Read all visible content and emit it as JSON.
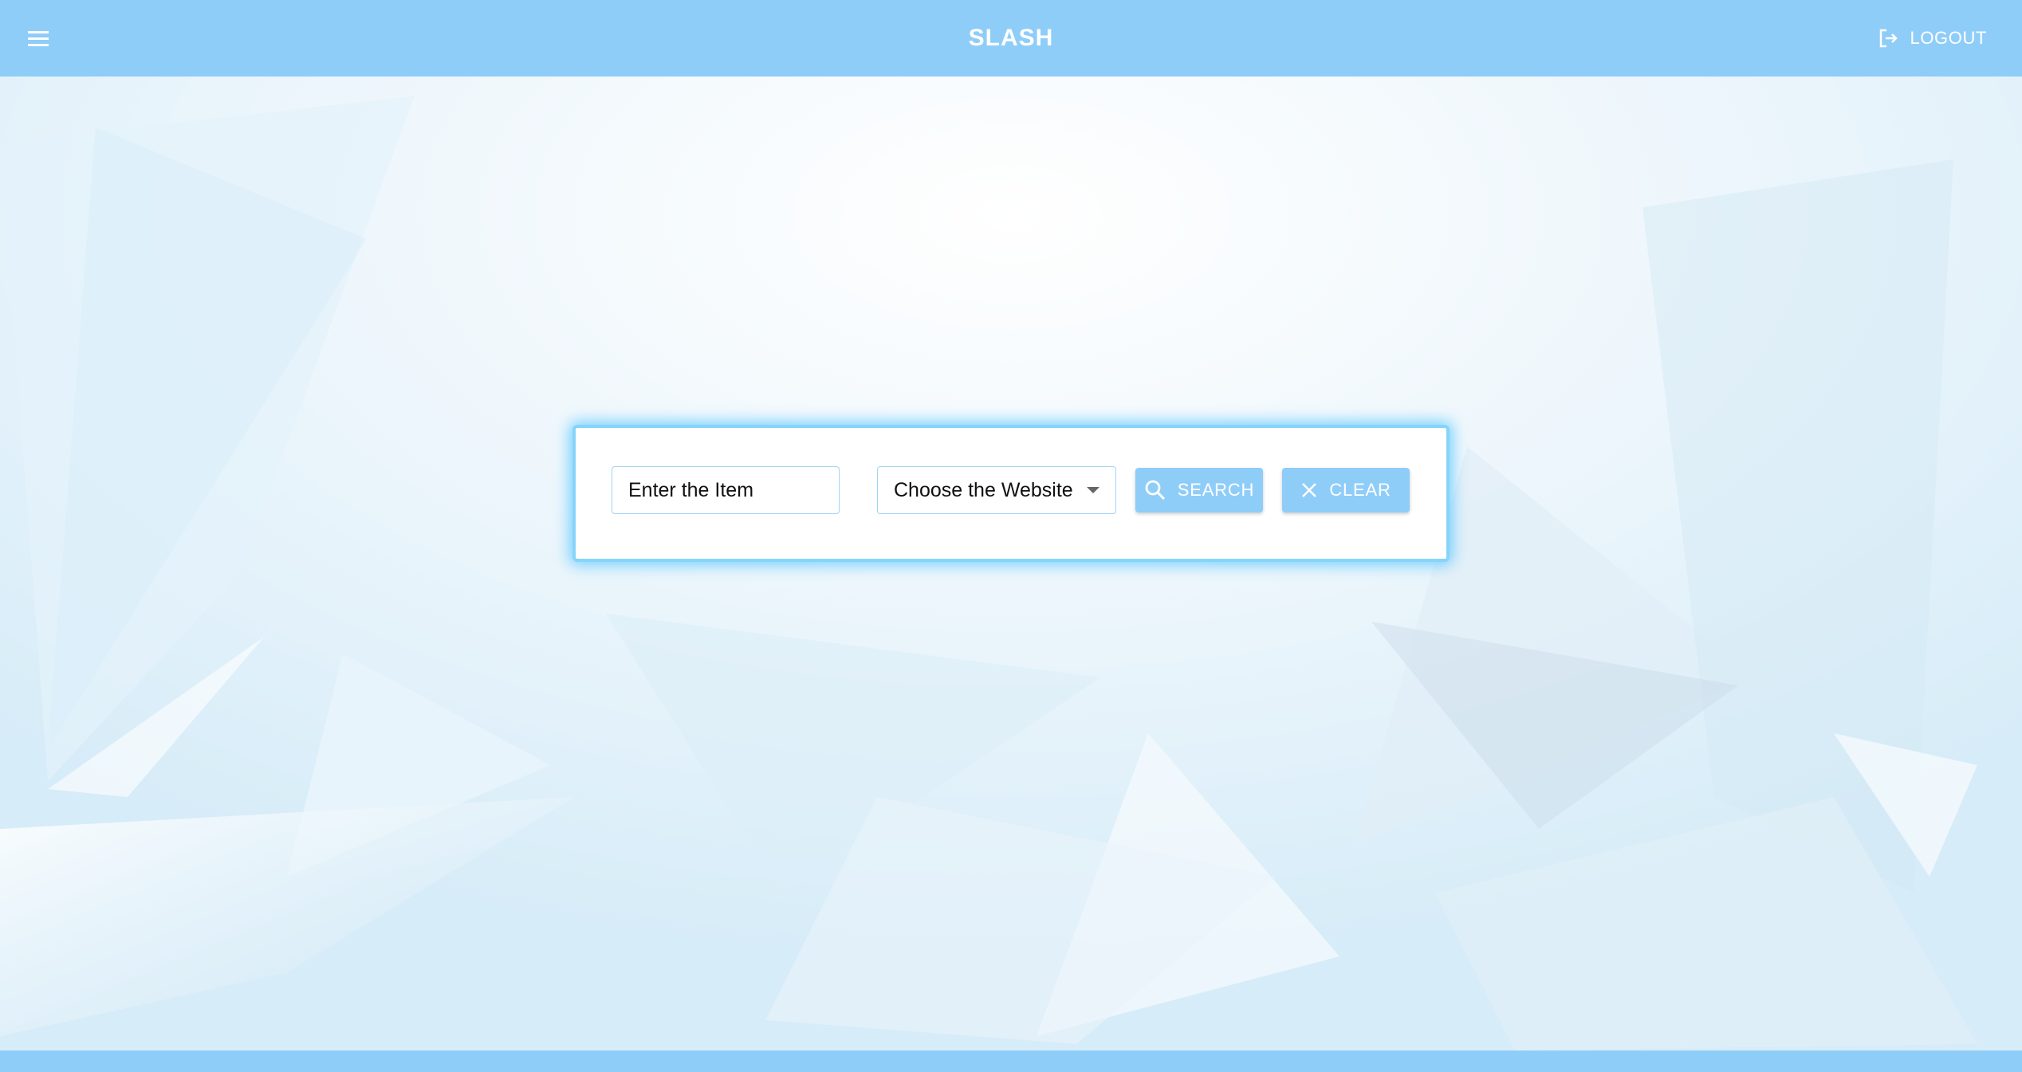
{
  "app": {
    "title": "SLASH"
  },
  "header": {
    "menu_icon": "menu-icon",
    "logout_label": "LOGOUT",
    "logout_icon": "logout-icon"
  },
  "search": {
    "item_placeholder": "Enter the Item",
    "item_value": "",
    "website_select_label": "Choose the Website",
    "search_label": "SEARCH",
    "search_icon": "search-icon",
    "clear_label": "CLEAR",
    "clear_icon": "close-icon"
  },
  "colors": {
    "appbar": "#8fcdf9",
    "accent_glow": "#4dc4ff",
    "card_border": "#87d4fb",
    "text_dark": "#111111"
  }
}
